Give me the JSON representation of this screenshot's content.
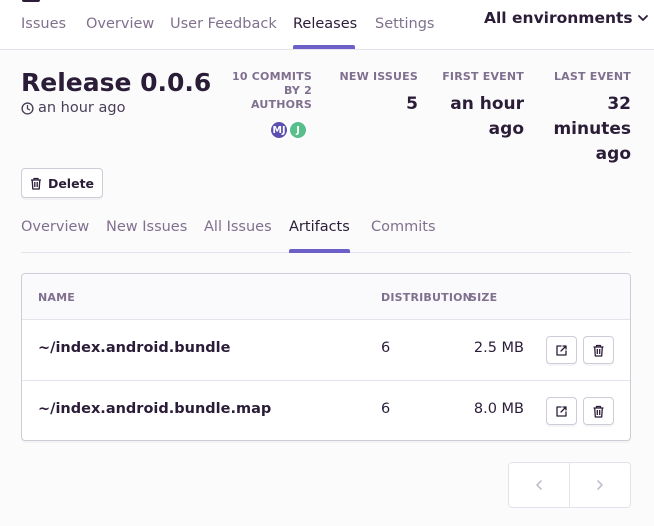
{
  "nav": {
    "tabs": [
      {
        "label": "Issues"
      },
      {
        "label": "Overview"
      },
      {
        "label": "User Feedback"
      },
      {
        "label": "Releases"
      },
      {
        "label": "Settings"
      }
    ],
    "active_tab": "Releases",
    "environment_selector": "All environments"
  },
  "release": {
    "title": "Release 0.0.6",
    "age": "an hour ago",
    "commits_label_line1": "10 COMMITS",
    "commits_label_line2": "BY 2",
    "commits_label_line3": "AUTHORS",
    "authors": [
      {
        "initials": "MJ",
        "color": "#5b4fb2"
      },
      {
        "initials": "J",
        "color": "#57be8c"
      }
    ],
    "stats": {
      "new_issues_label": "NEW ISSUES",
      "new_issues_value": "5",
      "first_event_label": "FIRST EVENT",
      "first_event_value_line1": "an hour",
      "first_event_value_line2": "ago",
      "last_event_label": "LAST EVENT",
      "last_event_value_line1": "32",
      "last_event_value_line2": "minutes",
      "last_event_value_line3": "ago"
    },
    "delete_label": "Delete"
  },
  "subnav": {
    "tabs": [
      {
        "label": "Overview"
      },
      {
        "label": "New Issues"
      },
      {
        "label": "All Issues"
      },
      {
        "label": "Artifacts"
      },
      {
        "label": "Commits"
      }
    ],
    "active_tab": "Artifacts"
  },
  "artifacts": {
    "columns": {
      "name": "NAME",
      "distribution": "DISTRIBUTION",
      "size": "SIZE"
    },
    "rows": [
      {
        "name": "~/index.android.bundle",
        "distribution": "6",
        "size": "2.5 MB"
      },
      {
        "name": "~/index.android.bundle.map",
        "distribution": "6",
        "size": "8.0 MB"
      }
    ]
  },
  "colors": {
    "accent": "#6c5fc7",
    "text": "#2b1d38",
    "muted": "#80708f",
    "border": "#d1cad8"
  }
}
